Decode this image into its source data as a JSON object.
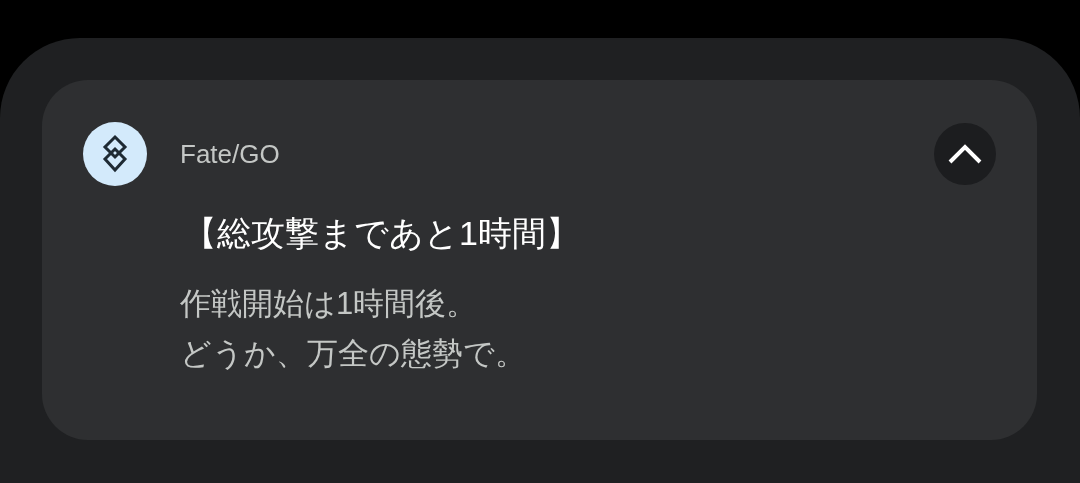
{
  "notification": {
    "app_name": "Fate/GO",
    "expanded": true,
    "title": "【総攻撃まであと1時間】",
    "body_lines": [
      "作戦開始は1時間後。",
      "どうか、万全の態勢で。"
    ]
  }
}
